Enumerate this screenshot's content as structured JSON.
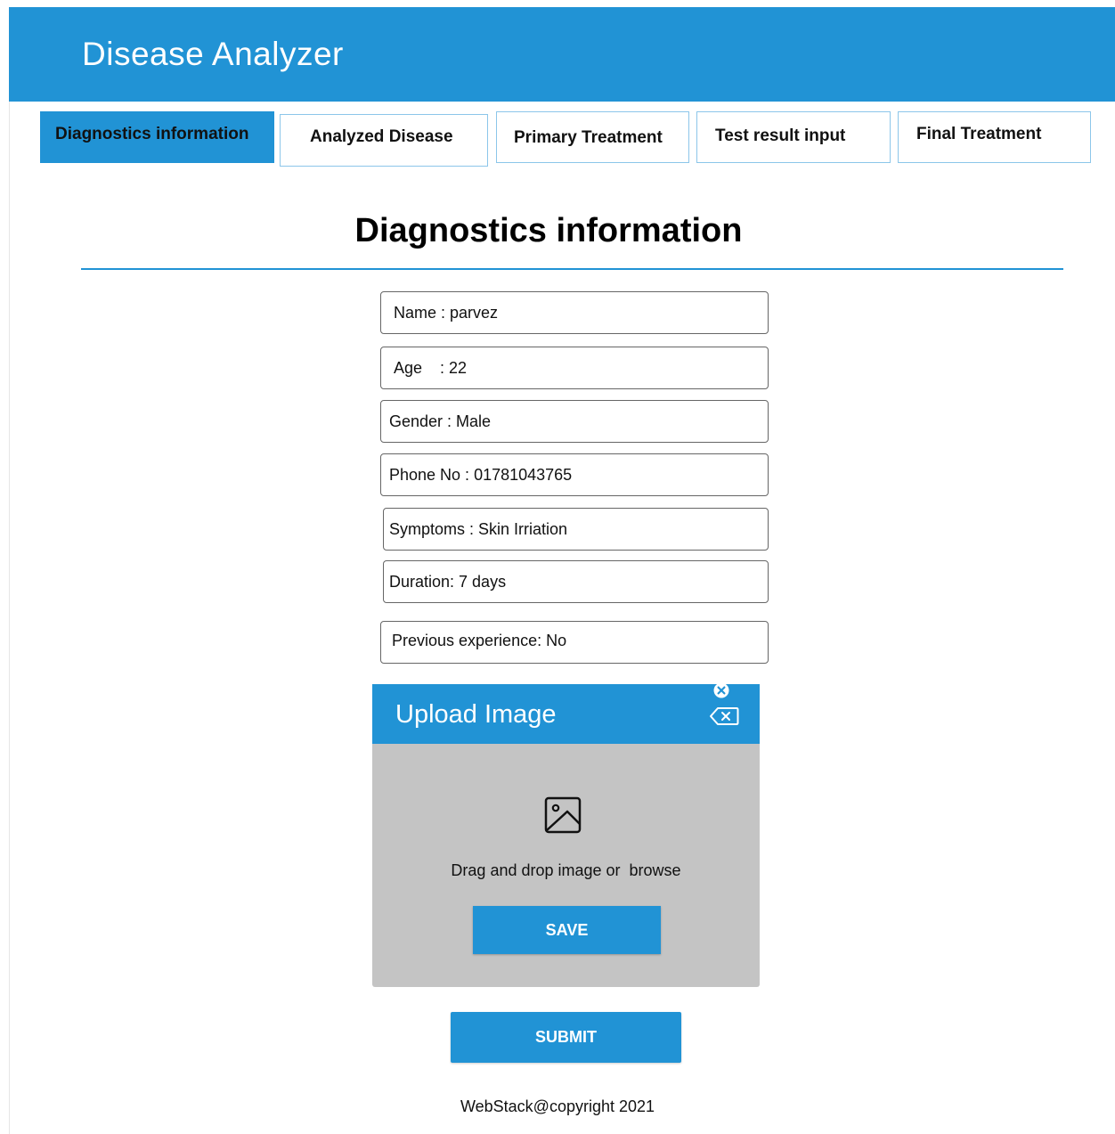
{
  "app": {
    "title": "Disease Analyzer"
  },
  "tabs": [
    {
      "label": "Diagnostics information",
      "active": true
    },
    {
      "label": "Analyzed Disease",
      "active": false
    },
    {
      "label": "Primary Treatment",
      "active": false
    },
    {
      "label": "Test result input",
      "active": false
    },
    {
      "label": "Final Treatment",
      "active": false
    }
  ],
  "main": {
    "heading": "Diagnostics information",
    "fields": [
      {
        "value": "Name : parvez"
      },
      {
        "value": "Age    : 22"
      },
      {
        "value": "Gender : Male"
      },
      {
        "value": "Phone No : 01781043765"
      },
      {
        "value": "Symptoms : Skin Irriation"
      },
      {
        "value": "Duration: 7 days"
      },
      {
        "value": "Previous experience: No"
      }
    ]
  },
  "upload": {
    "title": "Upload Image",
    "drop_text": "Drag and drop image or  browse",
    "save_label": "SAVE",
    "icons": [
      "close-circle-icon",
      "backspace-icon",
      "image-icon"
    ]
  },
  "actions": {
    "submit_label": "SUBMIT"
  },
  "footer": {
    "text": "WebStack@copyright 2021"
  },
  "colors": {
    "primary": "#2193d5",
    "upload_body": "#c4c4c4",
    "tab_border": "#8cc6ea"
  }
}
